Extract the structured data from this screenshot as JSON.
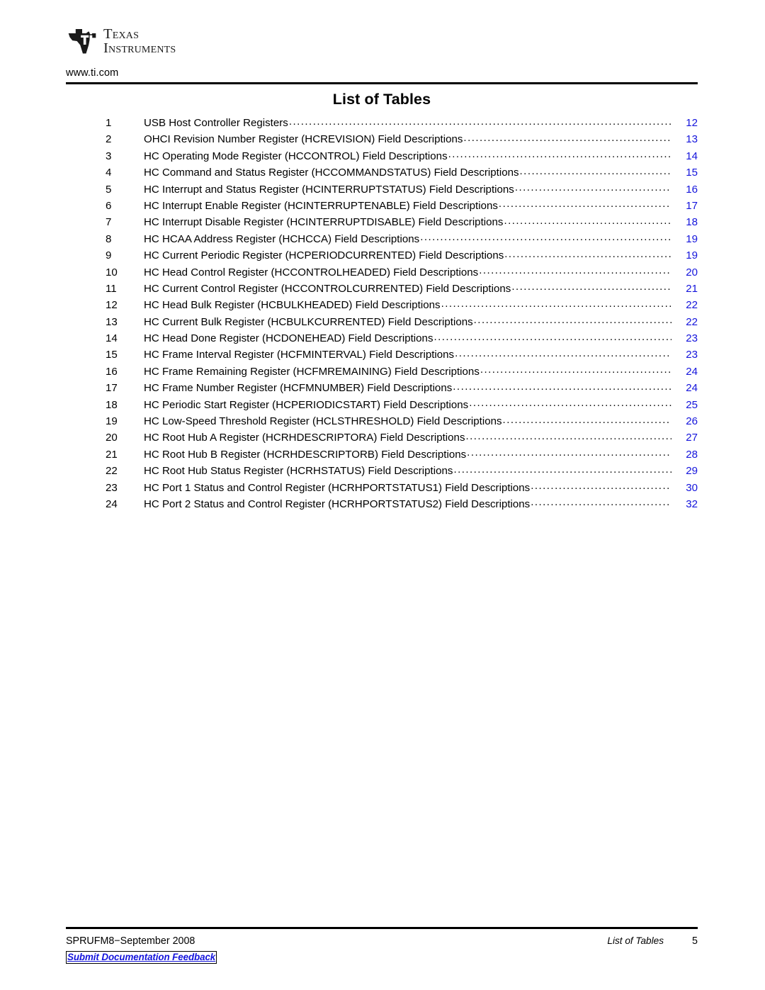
{
  "header": {
    "logo_name": "texas-instruments-logo",
    "wordmark_line1": "Texas",
    "wordmark_line2": "Instruments",
    "site_url": "www.ti.com"
  },
  "title": "List of Tables",
  "colors": {
    "link_blue": "#1414dc",
    "text_black": "#000000",
    "page_background": "#ffffff"
  },
  "toc": {
    "entries": [
      {
        "num": "1",
        "label": "USB Host Controller Registers",
        "page": "12"
      },
      {
        "num": "2",
        "label": "OHCI Revision Number Register (HCREVISION) Field Descriptions",
        "page": "13"
      },
      {
        "num": "3",
        "label": "HC Operating Mode Register (HCCONTROL) Field Descriptions",
        "page": "14"
      },
      {
        "num": "4",
        "label": "HC Command and Status Register (HCCOMMANDSTATUS) Field Descriptions",
        "page": "15"
      },
      {
        "num": "5",
        "label": "HC Interrupt and Status Register (HCINTERRUPTSTATUS) Field Descriptions",
        "page": "16"
      },
      {
        "num": "6",
        "label": "HC Interrupt Enable Register (HCINTERRUPTENABLE) Field Descriptions",
        "page": "17"
      },
      {
        "num": "7",
        "label": "HC Interrupt Disable Register (HCINTERRUPTDISABLE) Field Descriptions",
        "page": "18"
      },
      {
        "num": "8",
        "label": "HC HCAA Address Register (HCHCCA) Field Descriptions",
        "page": "19"
      },
      {
        "num": "9",
        "label": "HC Current Periodic Register (HCPERIODCURRENTED) Field Descriptions",
        "page": "19"
      },
      {
        "num": "10",
        "label": "HC Head Control Register (HCCONTROLHEADED) Field Descriptions",
        "page": "20"
      },
      {
        "num": "11",
        "label": "HC Current Control Register (HCCONTROLCURRENTED) Field Descriptions",
        "page": "21"
      },
      {
        "num": "12",
        "label": "HC Head Bulk Register (HCBULKHEADED) Field Descriptions",
        "page": "22"
      },
      {
        "num": "13",
        "label": "HC Current Bulk Register (HCBULKCURRENTED) Field Descriptions",
        "page": "22"
      },
      {
        "num": "14",
        "label": "HC Head Done Register (HCDONEHEAD) Field Descriptions",
        "page": "23"
      },
      {
        "num": "15",
        "label": "HC Frame Interval Register (HCFMINTERVAL) Field Descriptions",
        "page": "23"
      },
      {
        "num": "16",
        "label": "HC Frame Remaining Register (HCFMREMAINING) Field Descriptions",
        "page": "24"
      },
      {
        "num": "17",
        "label": "HC Frame Number Register (HCFMNUMBER) Field Descriptions",
        "page": "24"
      },
      {
        "num": "18",
        "label": "HC Periodic Start Register (HCPERIODICSTART) Field Descriptions",
        "page": "25"
      },
      {
        "num": "19",
        "label": "HC Low-Speed Threshold Register (HCLSTHRESHOLD) Field Descriptions",
        "page": "26"
      },
      {
        "num": "20",
        "label": "HC Root Hub A Register (HCRHDESCRIPTORA) Field Descriptions",
        "page": "27"
      },
      {
        "num": "21",
        "label": "HC Root Hub B Register (HCRHDESCRIPTORB) Field Descriptions",
        "page": "28"
      },
      {
        "num": "22",
        "label": "HC Root Hub Status Register (HCRHSTATUS) Field Descriptions",
        "page": "29"
      },
      {
        "num": "23",
        "label": "HC Port 1 Status and Control Register (HCRHPORTSTATUS1) Field Descriptions",
        "page": "30"
      },
      {
        "num": "24",
        "label": "HC Port 2 Status and Control Register (HCRHPORTSTATUS2) Field Descriptions",
        "page": "32"
      }
    ]
  },
  "footer": {
    "doc_id": "SPRUFM8−September 2008",
    "chapter": "List of Tables",
    "page_number": "5",
    "feedback_link": "Submit Documentation Feedback"
  }
}
